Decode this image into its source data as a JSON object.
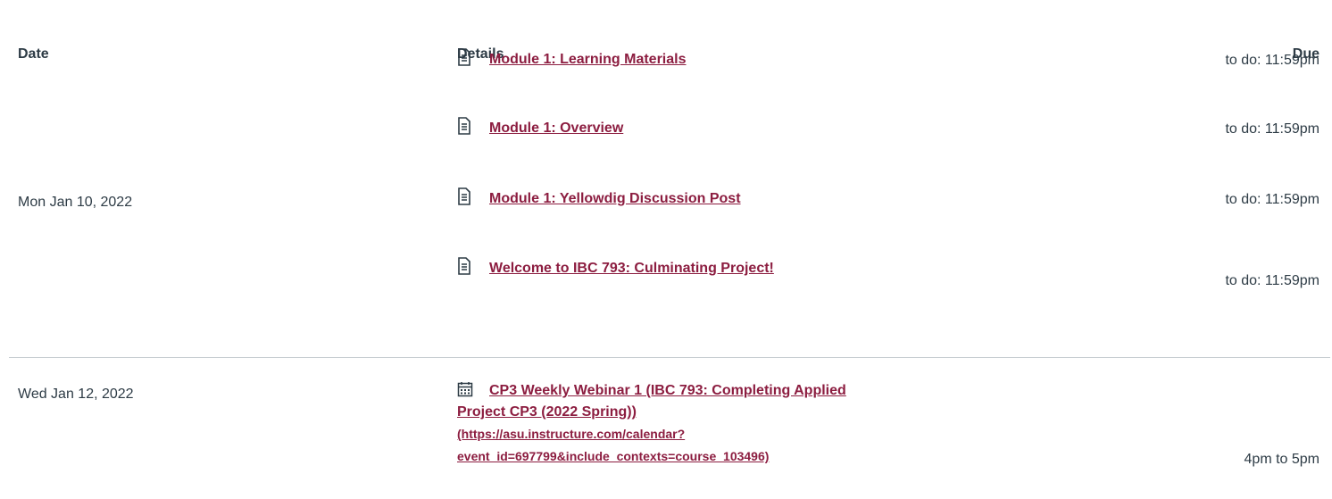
{
  "headers": {
    "date": "Date",
    "details": "Details",
    "due": "Due"
  },
  "groups": [
    {
      "date": "Mon Jan 10, 2022",
      "items": [
        {
          "icon": "page-icon",
          "title": "Module 1: Learning Materials",
          "due": "to do: 11:59pm"
        },
        {
          "icon": "page-icon",
          "title": "Module 1: Overview",
          "due": "to do: 11:59pm"
        },
        {
          "icon": "page-icon",
          "title": "Module 1: Yellowdig Discussion Post",
          "due": "to do: 11:59pm"
        },
        {
          "icon": "page-icon",
          "title": "Welcome to IBC 793: Culminating Project!",
          "due": "to do: 11:59pm"
        }
      ]
    },
    {
      "date": "Wed Jan 12, 2022",
      "items": [
        {
          "icon": "calendar-icon",
          "title": "CP3 Weekly Webinar 1 (IBC 793: Completing Applied Project CP3 (2022 Spring))",
          "url": "(https://asu.instructure.com/calendar?event_id=697799&include_contexts=course_103496)",
          "due": "4pm to 5pm"
        }
      ]
    }
  ],
  "colors": {
    "link": "#8c1d40",
    "text": "#2d3b45",
    "divider": "#c7cdd1"
  }
}
